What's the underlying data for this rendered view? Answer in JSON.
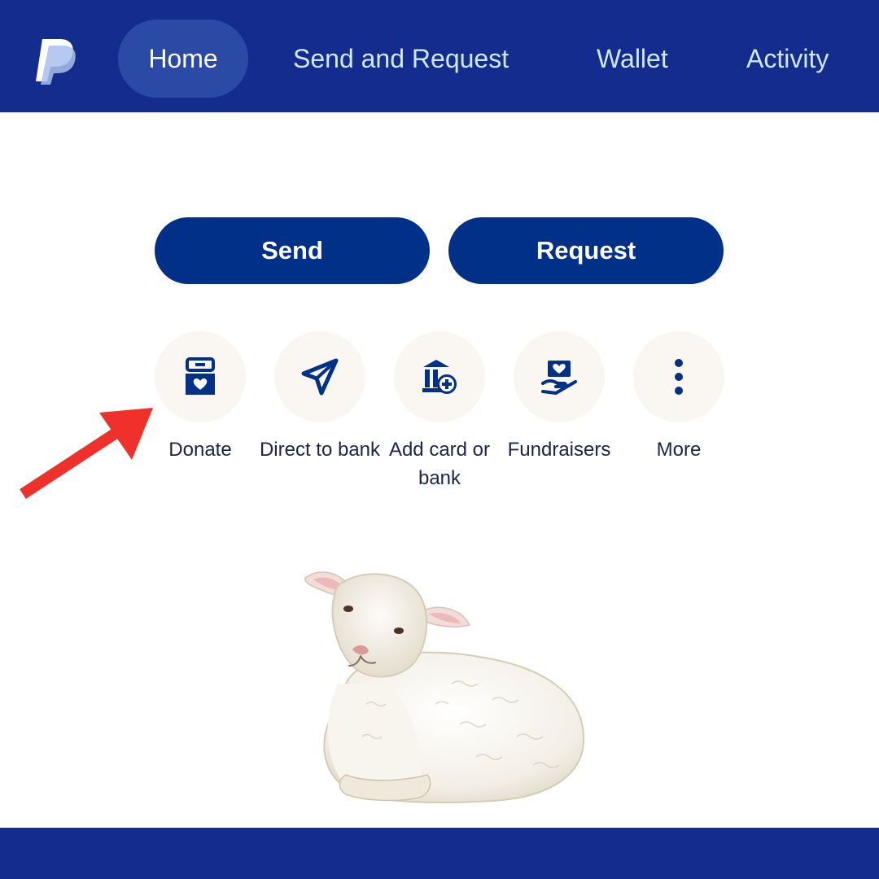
{
  "nav": {
    "logo_icon": "paypal-logo-icon",
    "items": [
      {
        "label": "Home",
        "active": true
      },
      {
        "label": "Send and Request",
        "active": false
      },
      {
        "label": "Wallet",
        "active": false
      },
      {
        "label": "Activity",
        "active": false
      }
    ]
  },
  "actions": {
    "send_label": "Send",
    "request_label": "Request"
  },
  "shortcuts": [
    {
      "label": "Donate",
      "icon": "donate-box-icon"
    },
    {
      "label": "Direct to bank",
      "icon": "paper-plane-icon"
    },
    {
      "label": "Add card or bank",
      "icon": "bank-add-icon"
    },
    {
      "label": "Fundraisers",
      "icon": "heart-hand-icon"
    },
    {
      "label": "More",
      "icon": "more-vertical-icon"
    }
  ],
  "annotation": {
    "icon": "red-arrow-icon"
  },
  "illustration": {
    "icon": "lamb-illustration"
  },
  "colors": {
    "nav_bg": "#142c8e",
    "nav_active_bg": "#2b4aa6",
    "button_bg": "#003087",
    "shortcut_bg": "#faf6f2",
    "icon_color": "#003087",
    "arrow_color": "#f0302b"
  }
}
